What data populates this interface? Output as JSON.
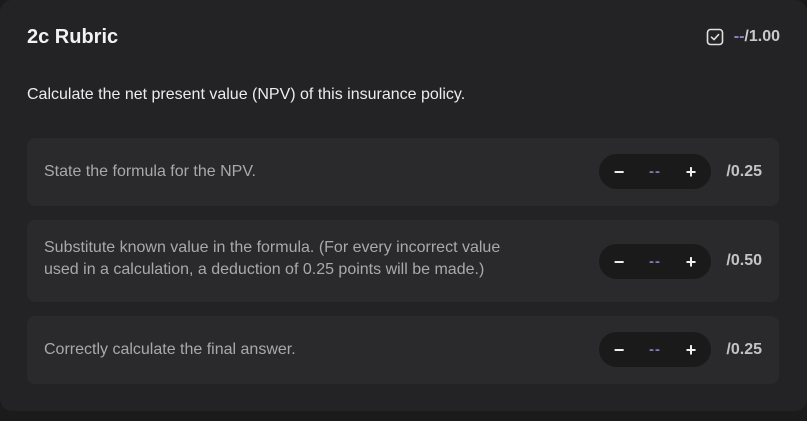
{
  "header": {
    "title": "2c Rubric",
    "score_dash": "--",
    "score_total": "/1.00",
    "score_icon": "checkbox-icon"
  },
  "question": "Calculate the net present value (NPV) of this insurance policy.",
  "criteria": [
    {
      "text_lines": [
        "State the formula for the NPV."
      ],
      "value": "--",
      "max": "/0.25",
      "minus": "−",
      "plus": "+"
    },
    {
      "text_lines": [
        "Substitute known value in the formula. (For every incorrect value",
        "used in a calculation, a deduction of 0.25 points will be made.)"
      ],
      "value": "--",
      "max": "/0.50",
      "minus": "−",
      "plus": "+"
    },
    {
      "text_lines": [
        "Correctly calculate the final answer."
      ],
      "value": "--",
      "max": "/0.25",
      "minus": "−",
      "plus": "+"
    }
  ],
  "colors": {
    "background": "#1b1b1c",
    "panel": "#232325",
    "card": "#2a2a2c",
    "accent": "#8c86c9"
  }
}
